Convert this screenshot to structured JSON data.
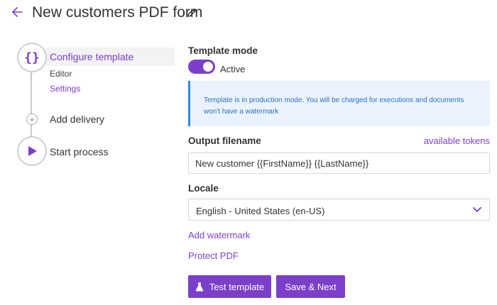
{
  "header": {
    "title": "New customers PDF form",
    "back_icon": "arrow-left-icon",
    "edit_icon": "pencil-icon"
  },
  "stepper": {
    "steps": [
      {
        "label": "Configure template",
        "icon": "braces-icon",
        "sub_items": [
          "Editor",
          "Settings"
        ]
      },
      {
        "label": "Add delivery",
        "icon": "plus-icon"
      },
      {
        "label": "Start process",
        "icon": "play-icon"
      }
    ]
  },
  "form": {
    "template_mode_label": "Template mode",
    "toggle_label": "Active",
    "toggle_on": true,
    "info_text": "Template is in production mode. You will be charged for executions and documents won't have a watermark",
    "output_label": "Output filename",
    "tokens_link": "available tokens",
    "output_value": "New customer {{FirstName}} {{LastName}}",
    "locale_label": "Locale",
    "locale_value": "English - United States (en-US)",
    "add_watermark_link": "Add watermark",
    "protect_pdf_link": "Protect PDF",
    "test_button": "Test template",
    "save_button": "Save & Next"
  },
  "colors": {
    "accent": "#7b3fc9",
    "info_bg": "#eaf3fd",
    "info_border": "#2f8be6",
    "info_text": "#2a6fbd"
  }
}
